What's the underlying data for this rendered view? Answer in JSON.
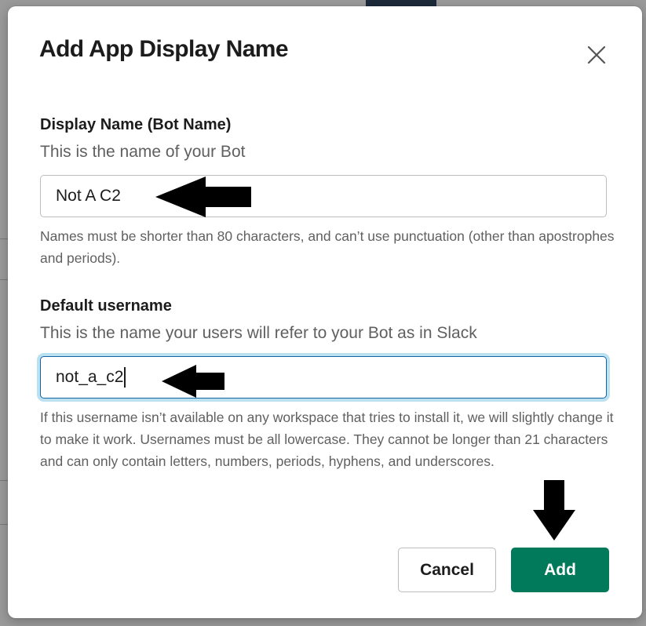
{
  "dialog": {
    "title": "Add App Display Name",
    "close_icon": "close-icon"
  },
  "display_name": {
    "label": "Display Name (Bot Name)",
    "help": "This is the name of your Bot",
    "value": "Not A C2",
    "note": "Names must be shorter than 80 characters, and can’t use punctuation (other than apostrophes and periods)."
  },
  "username": {
    "label": "Default username",
    "help": "This is the name your users will refer to your Bot as in Slack",
    "value": "not_a_c2",
    "note": "If this username isn’t available on any workspace that tries to install it, we will slightly change it to make it work. Usernames must be all lowercase. They cannot be longer than 21 characters and can only contain letters, numbers, periods, hyphens, and underscores."
  },
  "actions": {
    "cancel_label": "Cancel",
    "add_label": "Add"
  },
  "colors": {
    "primary": "#007a5a",
    "focus": "#1264a3"
  }
}
